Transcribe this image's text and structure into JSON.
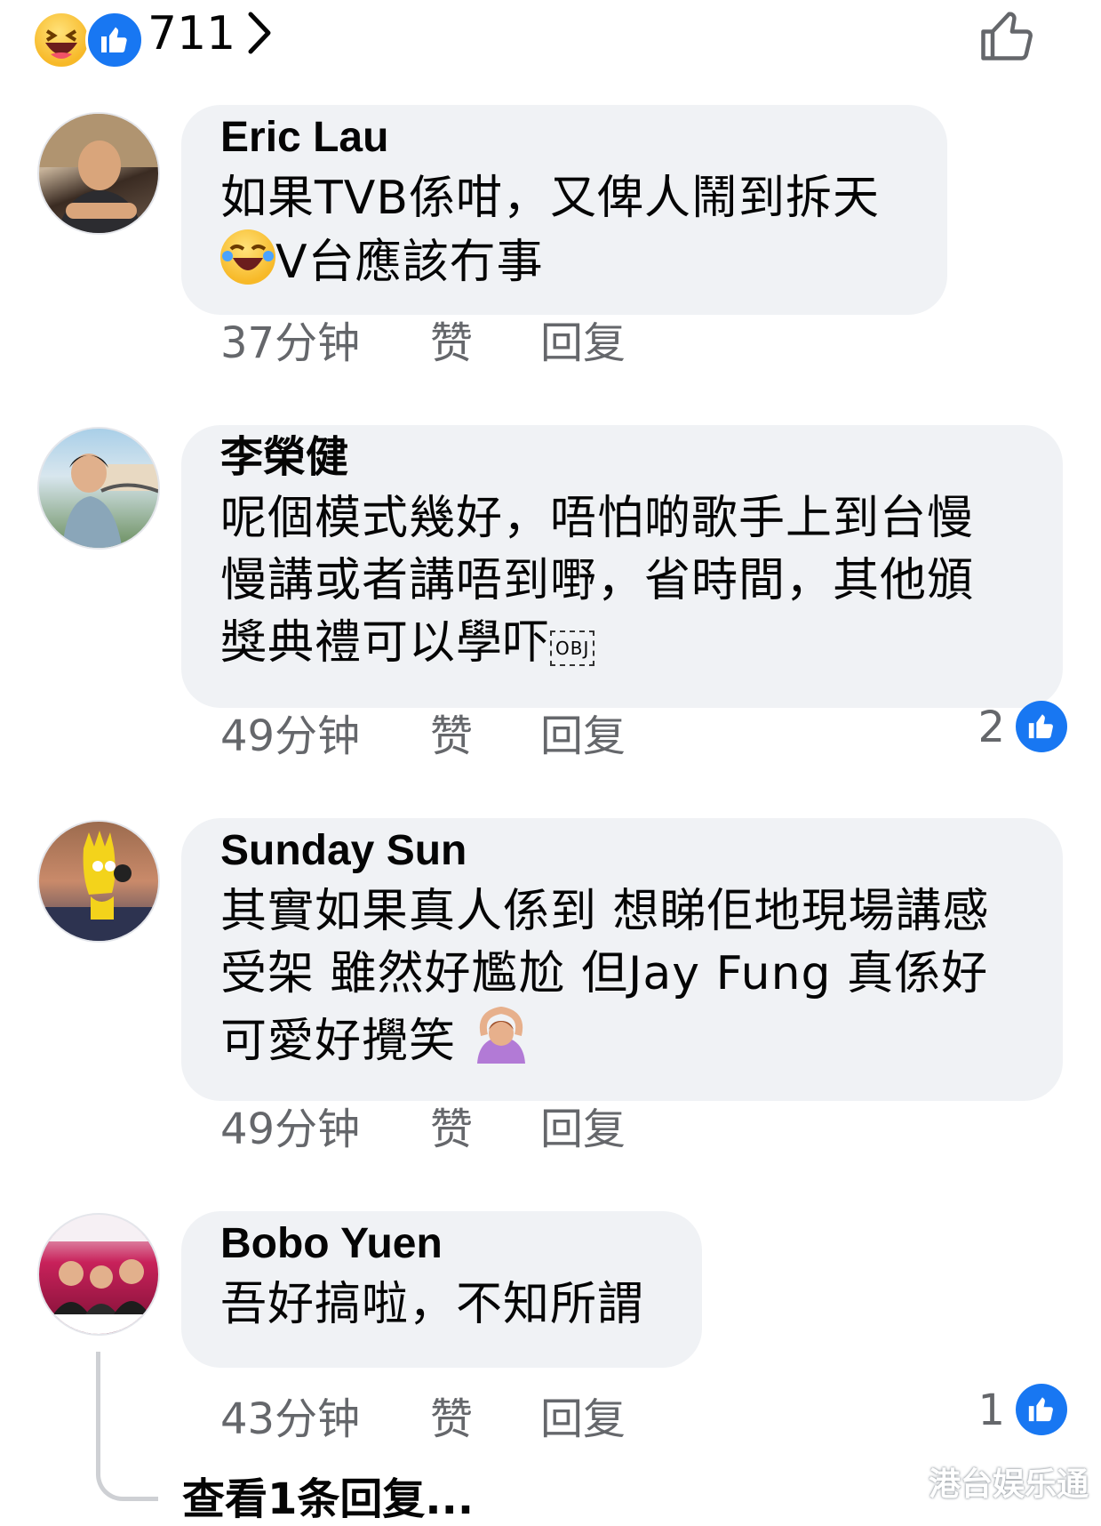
{
  "reactions": {
    "count": "711",
    "icons": [
      "haha-icon",
      "like-icon"
    ]
  },
  "comments": [
    {
      "author": "Eric Lau",
      "lines": [
        "如果TVB係咁，又俾人鬧到拆天",
        "V台應該冇事"
      ],
      "time": "37分钟",
      "like_label": "赞",
      "reply_label": "回复",
      "reaction_count": ""
    },
    {
      "author": "李榮健",
      "lines": [
        "呢個模式幾好，唔怕啲歌手上到台慢",
        "慢講或者講唔到嘢，省時間，其他頒",
        "獎典禮可以學吓"
      ],
      "obj_glyph": "OBJ",
      "time": "49分钟",
      "like_label": "赞",
      "reply_label": "回复",
      "reaction_count": "2"
    },
    {
      "author": "Sunday Sun",
      "lines": [
        "其實如果真人係到 想睇佢地現場講感",
        "受架 雖然好尷尬 但Jay Fung 真係好",
        "可愛好攪笑 "
      ],
      "time": "49分钟",
      "like_label": "赞",
      "reply_label": "回复",
      "reaction_count": ""
    },
    {
      "author": "Bobo Yuen",
      "lines": [
        "吾好搞啦，不知所謂"
      ],
      "time": "43分钟",
      "like_label": "赞",
      "reply_label": "回复",
      "reaction_count": "1"
    }
  ],
  "view_replies": "查看1条回复...",
  "watermark": "港台娱乐通"
}
